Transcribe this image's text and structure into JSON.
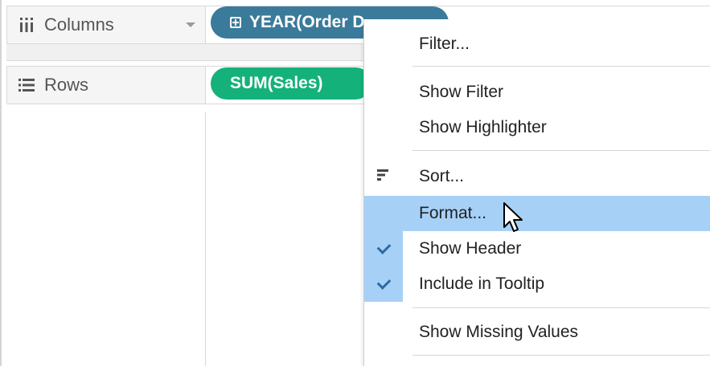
{
  "shelves": {
    "columns": {
      "label": "Columns",
      "pill": "YEAR(Order D"
    },
    "rows": {
      "label": "Rows",
      "pill": "SUM(Sales)"
    }
  },
  "colors": {
    "dimension_pill": "#3a7a9a",
    "measure_pill": "#14b27a",
    "menu_highlight": "#a7d0f7"
  },
  "context_menu": {
    "items": [
      {
        "label": "Filter...",
        "icon": ""
      },
      {
        "label": "Show Filter",
        "icon": ""
      },
      {
        "label": "Show Highlighter",
        "icon": ""
      },
      {
        "label": "Sort...",
        "icon": "sort-icon"
      },
      {
        "label": "Format...",
        "icon": "",
        "state": "hovered"
      },
      {
        "label": "Show Header",
        "icon": "checkmark-icon",
        "checked": true
      },
      {
        "label": "Include in Tooltip",
        "icon": "checkmark-icon",
        "checked": true
      },
      {
        "label": "Show Missing Values",
        "icon": ""
      }
    ]
  }
}
